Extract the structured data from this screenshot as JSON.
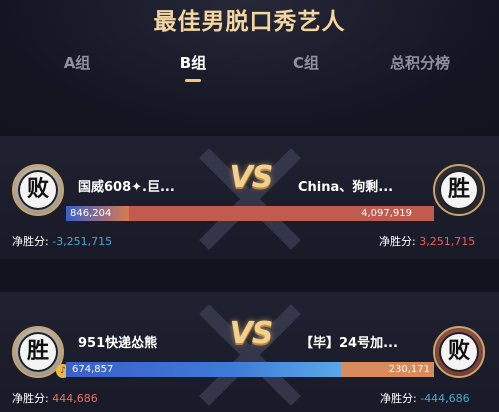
{
  "page": {
    "title": "最佳男脱口秀艺人"
  },
  "tabs": [
    {
      "label": "A组",
      "active": false
    },
    {
      "label": "B组",
      "active": true
    },
    {
      "label": "C组",
      "active": false
    },
    {
      "label": "总积分榜",
      "active": false
    }
  ],
  "matches": [
    {
      "vs_label": "VS",
      "left": {
        "result": "败",
        "name": "国威608✦.巨...",
        "score": "846,204",
        "net_label": "净胜分:",
        "net_value": "-3,251,715",
        "progress_fraction": 0.171
      },
      "right": {
        "result": "胜",
        "name": "China、狗剩...",
        "score": "4,097,919",
        "net_label": "净胜分:",
        "net_value": "3,251,715"
      }
    },
    {
      "vs_label": "VS",
      "left": {
        "result": "胜",
        "name": "951快递怂熊",
        "score": "674,857",
        "net_label": "净胜分:",
        "net_value": "444,686",
        "progress_fraction": 0.746
      },
      "right": {
        "result": "败",
        "name": "【毕】24号加...",
        "score": "230,171",
        "net_label": "净胜分:",
        "net_value": "-444,686"
      }
    }
  ],
  "colors": {
    "accent_gold": "#f0c77c",
    "bar_blue": "#3b5fc9",
    "bar_red": "#c75048",
    "negative": "#4aa8d4",
    "positive": "#e8605a"
  }
}
